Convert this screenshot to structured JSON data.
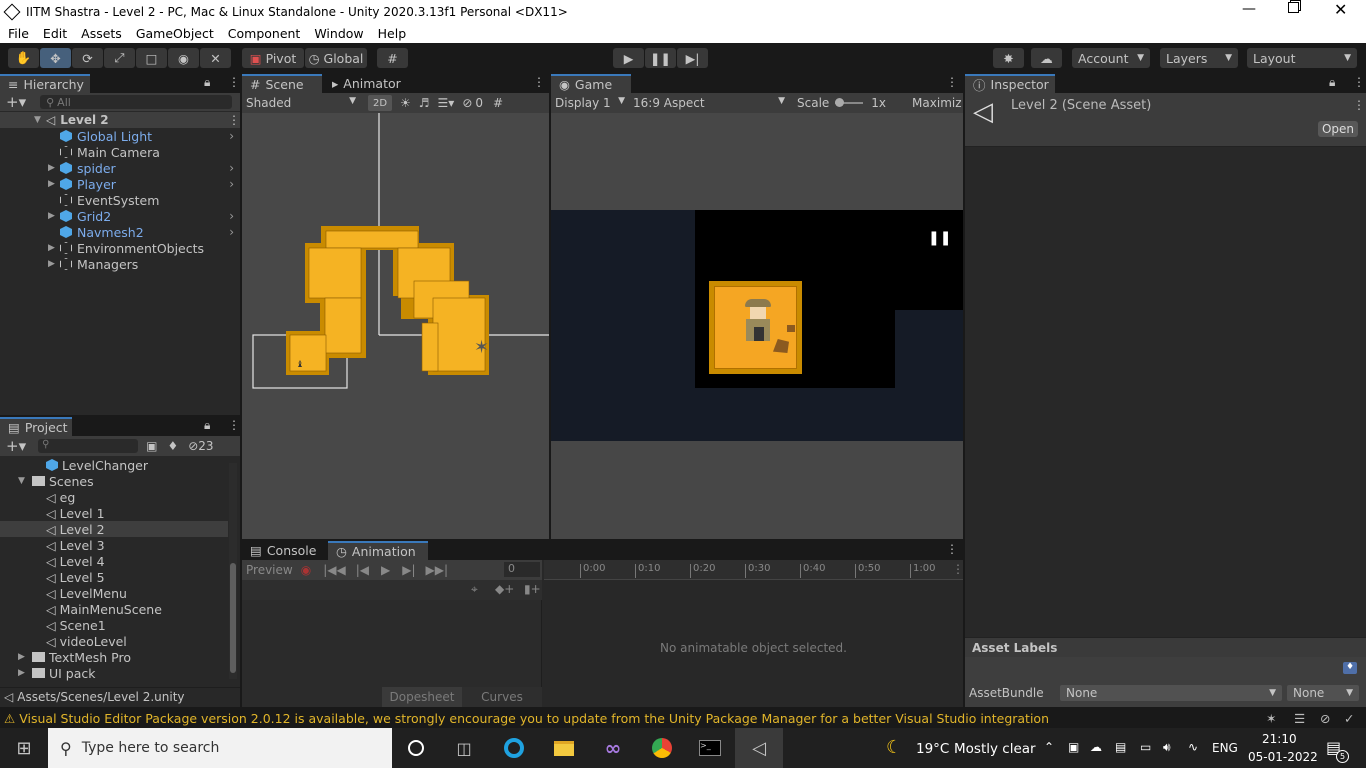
{
  "window": {
    "title": "IITM Shastra - Level 2 - PC, Mac & Linux Standalone - Unity 2020.3.13f1 Personal <DX11>"
  },
  "menu": [
    "File",
    "Edit",
    "Assets",
    "GameObject",
    "Component",
    "Window",
    "Help"
  ],
  "toolbar": {
    "pivot": "Pivot",
    "global": "Global",
    "account": "Account",
    "layers": "Layers",
    "layout": "Layout"
  },
  "hierarchy": {
    "tab": "Hierarchy",
    "search_placeholder": "All",
    "scene": "Level 2",
    "items": [
      {
        "label": "Global Light",
        "blue": true,
        "expand": false,
        "chev": true
      },
      {
        "label": "Main Camera",
        "blue": false,
        "expand": false,
        "chev": false
      },
      {
        "label": "spider",
        "blue": true,
        "expand": true,
        "chev": true
      },
      {
        "label": "Player",
        "blue": true,
        "expand": true,
        "chev": true
      },
      {
        "label": "EventSystem",
        "blue": false,
        "expand": false,
        "chev": false
      },
      {
        "label": "Grid2",
        "blue": true,
        "expand": true,
        "chev": true
      },
      {
        "label": "Navmesh2",
        "blue": true,
        "expand": false,
        "chev": true
      },
      {
        "label": "EnvironmentObjects",
        "blue": false,
        "expand": true,
        "chev": false
      },
      {
        "label": "Managers",
        "blue": false,
        "expand": true,
        "chev": false
      }
    ]
  },
  "scene": {
    "tab": "Scene",
    "tab2": "Animator",
    "shading": "Shaded",
    "mode2d": "2D",
    "gizmo_count": "0"
  },
  "game": {
    "tab": "Game",
    "display": "Display 1",
    "aspect": "16:9 Aspect",
    "scale_label": "Scale",
    "scale_value": "1x",
    "maximize": "Maximiz"
  },
  "inspector": {
    "tab": "Inspector",
    "asset": "Level 2 (Scene Asset)",
    "open": "Open",
    "asset_labels": "Asset Labels",
    "asset_bundle": "AssetBundle",
    "bundle_value": "None",
    "variant_value": "None"
  },
  "project": {
    "tab": "Project",
    "hidden_count": "23",
    "items": [
      {
        "label": "LevelChanger",
        "kind": "prefab",
        "indent": 2
      },
      {
        "label": "Scenes",
        "kind": "folder-open",
        "indent": 1
      },
      {
        "label": "eg",
        "kind": "scene",
        "indent": 2
      },
      {
        "label": "Level 1",
        "kind": "scene",
        "indent": 2
      },
      {
        "label": "Level 2",
        "kind": "scene",
        "indent": 2,
        "selected": true
      },
      {
        "label": "Level 3",
        "kind": "scene",
        "indent": 2
      },
      {
        "label": "Level 4",
        "kind": "scene",
        "indent": 2
      },
      {
        "label": "Level 5",
        "kind": "scene",
        "indent": 2
      },
      {
        "label": "LevelMenu",
        "kind": "scene",
        "indent": 2
      },
      {
        "label": "MainMenuScene",
        "kind": "scene",
        "indent": 2
      },
      {
        "label": "Scene1",
        "kind": "scene",
        "indent": 2
      },
      {
        "label": "videoLevel",
        "kind": "scene",
        "indent": 2
      },
      {
        "label": "TextMesh Pro",
        "kind": "folder",
        "indent": 1
      },
      {
        "label": "UI pack",
        "kind": "folder",
        "indent": 1
      }
    ],
    "path": "Assets/Scenes/Level 2.unity"
  },
  "console": {
    "tab": "Console",
    "tab2": "Animation",
    "preview": "Preview",
    "frame": "0",
    "times": [
      "0:00",
      "0:10",
      "0:20",
      "0:30",
      "0:40",
      "0:50",
      "1:00"
    ],
    "empty": "No animatable object selected.",
    "dopesheet": "Dopesheet",
    "curves": "Curves"
  },
  "status": {
    "message": "Visual Studio Editor Package version 2.0.12 is available, we strongly encourage you to update from the Unity Package Manager for a better Visual Studio integration"
  },
  "taskbar": {
    "search_placeholder": "Type here to search",
    "weather_temp": "19°C",
    "weather_desc": "Mostly clear",
    "lang": "ENG",
    "time": "21:10",
    "date": "05-01-2022",
    "notif_count": "5"
  }
}
